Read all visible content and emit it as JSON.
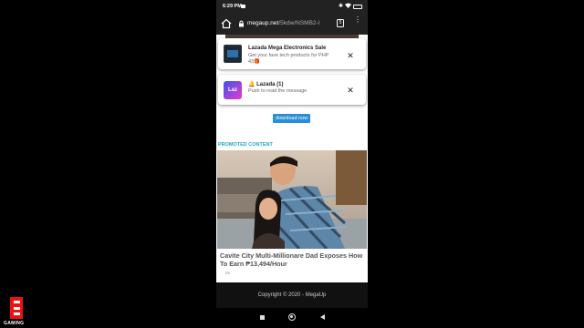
{
  "status_bar": {
    "time": "6:29 PM",
    "icons": [
      "recording-icon",
      "bluetooth-icon",
      "wifi-icon",
      "battery-icon"
    ]
  },
  "browser": {
    "url_domain": "megaup.net",
    "url_path": "/5kdw/NSMB2-l",
    "tab_count": "5"
  },
  "notifications": [
    {
      "title": "Lazada Mega Electronics Sale",
      "body": "Get your fave tech products for PHP 43🎁",
      "close": "✕"
    },
    {
      "title": "🔔 Lazada (1)",
      "body": "Push to read the message",
      "thumb_text": "Laz",
      "close": "✕"
    }
  ],
  "page": {
    "download_button": "download now",
    "promoted_heading": "PROMOTED CONTENT",
    "ad_caption": "Cavite City Multi-Millionare Dad Exposes How To Earn ₱13,494/Hour",
    "ad_tag": "ss",
    "footer": "Copyright © 2020 - MegaUp"
  },
  "watermark": {
    "text": "GAMING"
  },
  "colors": {
    "accent_teal": "#18a9c9",
    "button_blue": "#2a8fd6",
    "toolbar": "#222222"
  }
}
